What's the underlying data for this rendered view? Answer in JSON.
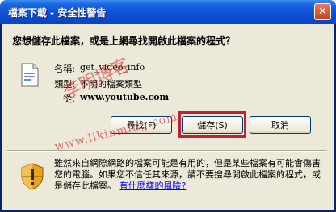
{
  "window": {
    "title": "檔案下載 - 安全性警告",
    "close_glyph": "✕"
  },
  "dialog": {
    "question": "您想儲存此檔案，或是上網尋找開啟此檔案的程式？",
    "file_info": [
      {
        "label": "名稱:",
        "value": "get_video_info"
      },
      {
        "label": "類型:",
        "value": "不明的檔案類型"
      },
      {
        "label": "從:",
        "value": "www.youtube.com"
      }
    ],
    "buttons": {
      "find": "尋找(F)",
      "save": "儲存(S)",
      "cancel": "取消"
    },
    "warning_text": "雖然來自網際網路的檔案可能是有用的，但是某些檔案有可能會傷害您的電腦。如果您不信任其來源，請不要搜尋開啟此檔案的程式，或是儲存此檔案。",
    "warning_link": "有什麼樣的風險?"
  },
  "watermark": {
    "name": "李明博客",
    "url": "www.likinming.com"
  },
  "icons": {
    "file": "file-icon",
    "shield": "shield-warning-icon"
  },
  "colors": {
    "titlebar": "#0b4ed2",
    "dialog_bg": "#ece9d8",
    "highlight": "#c8202a",
    "link": "#0000ff"
  }
}
